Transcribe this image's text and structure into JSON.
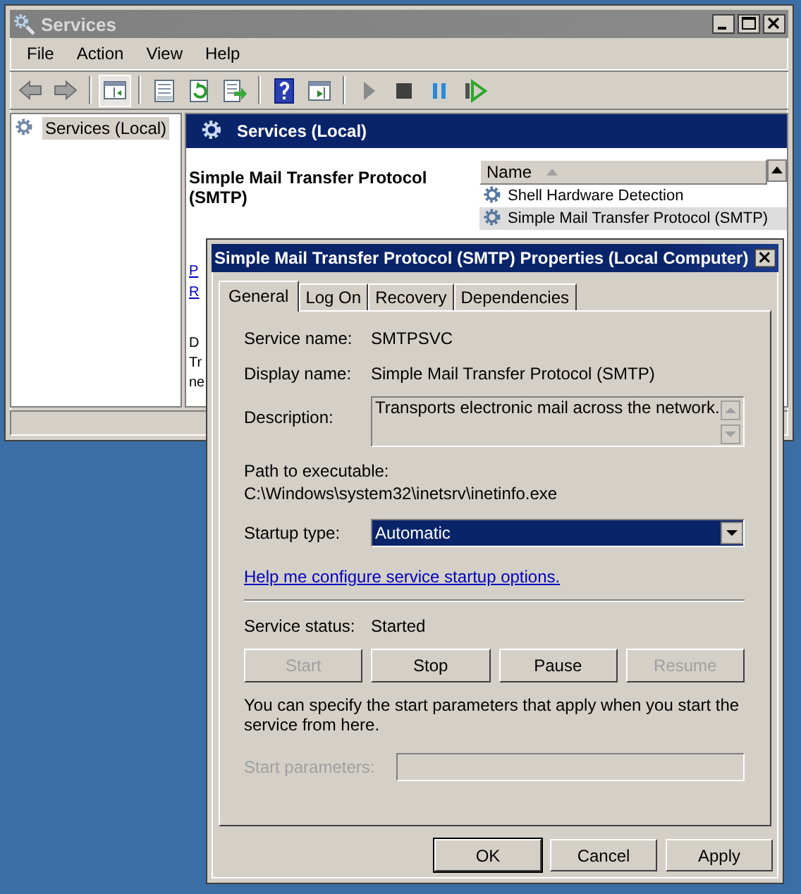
{
  "window": {
    "title": "Services"
  },
  "menu": [
    {
      "label": "File"
    },
    {
      "label": "Action"
    },
    {
      "label": "View"
    },
    {
      "label": "Help"
    }
  ],
  "toolbar": [
    {
      "kind": "back"
    },
    {
      "kind": "forward"
    },
    {
      "kind": "sep"
    },
    {
      "kind": "tree"
    },
    {
      "kind": "sep"
    },
    {
      "kind": "properties"
    },
    {
      "kind": "refresh"
    },
    {
      "kind": "export"
    },
    {
      "kind": "sep"
    },
    {
      "kind": "help"
    },
    {
      "kind": "view"
    },
    {
      "kind": "sep"
    },
    {
      "kind": "play"
    },
    {
      "kind": "stop"
    },
    {
      "kind": "pause"
    },
    {
      "kind": "restart"
    }
  ],
  "tree": [
    {
      "label": "Services (Local)",
      "selected": true
    }
  ],
  "pane": {
    "title": "Services (Local)",
    "service_name": "Simple Mail Transfer Protocol (SMTP)",
    "links": [
      "P",
      "R"
    ],
    "description_lines": [
      "D",
      "Tr",
      "ne"
    ]
  },
  "list": {
    "columns": [
      {
        "label": "Name"
      }
    ],
    "rows": [
      {
        "name": "Shell Hardware Detection",
        "selected": false
      },
      {
        "name": "Simple Mail Transfer Protocol (SMTP)",
        "selected": true
      }
    ]
  },
  "dialog": {
    "title": "Simple Mail Transfer Protocol (SMTP) Properties (Local Computer)",
    "tabs": [
      {
        "label": "General",
        "selected": true
      },
      {
        "label": "Log On",
        "selected": false
      },
      {
        "label": "Recovery",
        "selected": false
      },
      {
        "label": "Dependencies",
        "selected": false
      }
    ],
    "fields": [
      {
        "label": "Service name:",
        "value": "SMTPSVC"
      },
      {
        "label": "Display name:",
        "value": "Simple Mail Transfer Protocol (SMTP)"
      }
    ],
    "description": {
      "label": "Description:",
      "value": "Transports electronic mail across the network."
    },
    "path": {
      "label": "Path to executable:",
      "value": "C:\\Windows\\system32\\inetsrv\\inetinfo.exe"
    },
    "startup": {
      "label": "Startup type:",
      "value": "Automatic"
    },
    "help_link": "Help me configure service startup options.",
    "status": {
      "label": "Service status:",
      "value": "Started"
    },
    "control_buttons": [
      {
        "label": "Start",
        "disabled": true
      },
      {
        "label": "Stop",
        "disabled": false
      },
      {
        "label": "Pause",
        "disabled": false
      },
      {
        "label": "Resume",
        "disabled": true
      }
    ],
    "note": "You can specify the start parameters that apply when you start the service from here.",
    "start_params": {
      "label": "Start parameters:",
      "disabled": true
    },
    "buttons": [
      {
        "label": "OK",
        "default": true
      },
      {
        "label": "Cancel",
        "default": false
      },
      {
        "label": "Apply",
        "default": false
      }
    ]
  }
}
